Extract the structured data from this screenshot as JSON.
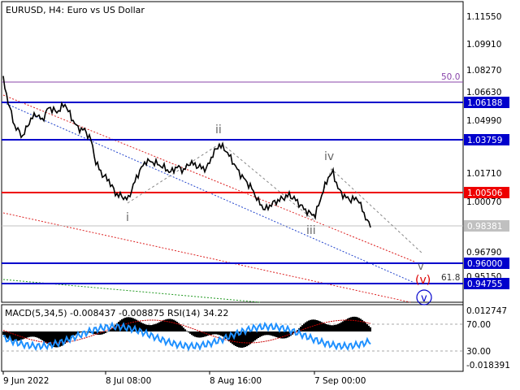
{
  "header": {
    "symbol_info": "EURUSD, H4:  Euro vs US Dollar"
  },
  "price_axis": {
    "ticks": [
      "1.11550",
      "1.09910",
      "1.08270",
      "1.06630",
      "1.04990",
      "1.01710",
      "1.00070",
      "0.96790",
      "0.95150"
    ]
  },
  "levels": [
    {
      "value": 1.06188,
      "label": "1.06188",
      "color": "#0000cc"
    },
    {
      "value": 1.03759,
      "label": "1.03759",
      "color": "#0000cc"
    },
    {
      "value": 1.00506,
      "label": "1.00506",
      "color": "#ee0000"
    },
    {
      "value": 0.96,
      "label": "0.96000",
      "color": "#0000cc"
    },
    {
      "value": 0.94755,
      "label": "0.94755",
      "color": "#0000cc"
    }
  ],
  "current_price": {
    "value": 0.98381,
    "label": "0.98381"
  },
  "fib_levels": [
    {
      "label": "50.0",
      "color": "#8844aa"
    },
    {
      "label": "61.8",
      "color": "#333333"
    }
  ],
  "waves": [
    {
      "label": "i",
      "color": "#666666"
    },
    {
      "label": "ii",
      "color": "#666666"
    },
    {
      "label": "iii",
      "color": "#666666"
    },
    {
      "label": "iv",
      "color": "#666666"
    },
    {
      "label": "v",
      "color": "#666666"
    },
    {
      "label": "(v)",
      "color": "#dd0000"
    },
    {
      "label": "v",
      "color": "#0000cc"
    }
  ],
  "indicator": {
    "label": "MACD(5,34,5) -0.008437 -0.008875 RSI(14) 34.22",
    "ticks": [
      "0.012747",
      "70.00",
      "30.00",
      "-0.018391"
    ]
  },
  "time_axis": {
    "labels": [
      "9 Jun 2022",
      "8 Jul 08:00",
      "8 Aug 16:00",
      "7 Sep 00:00"
    ]
  },
  "colors": {
    "candles": "#000000",
    "rsi": "#1e90ff",
    "macd_signal": "#cc0000",
    "trend_red": "#dd2222",
    "trend_blue": "#2244cc",
    "trend_green": "#229922",
    "wave_line": "#888888"
  }
}
